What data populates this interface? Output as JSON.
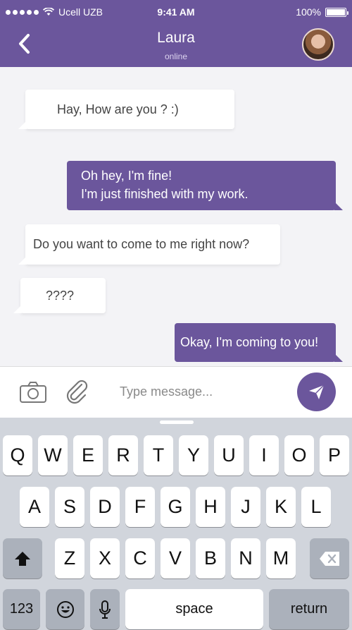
{
  "status_bar": {
    "carrier": "Ucell UZB",
    "time": "9:41 AM",
    "battery": "100%"
  },
  "contact": {
    "name": "Laura",
    "status": "online"
  },
  "messages": [
    {
      "direction": "incoming",
      "lines": [
        "Hay, How are you ? :)"
      ]
    },
    {
      "direction": "outgoing",
      "lines": [
        "Oh hey, I'm fine!",
        "I'm just finished with my work."
      ]
    },
    {
      "direction": "incoming",
      "lines": [
        "Do you want to come to me right now?"
      ]
    },
    {
      "direction": "incoming",
      "lines": [
        "????"
      ]
    },
    {
      "direction": "outgoing",
      "lines": [
        "Okay, I'm coming to you!"
      ]
    }
  ],
  "composer": {
    "placeholder": "Type message..."
  },
  "keyboard": {
    "row1": [
      "Q",
      "W",
      "E",
      "R",
      "T",
      "Y",
      "U",
      "I",
      "O",
      "P"
    ],
    "row2": [
      "A",
      "S",
      "D",
      "F",
      "G",
      "H",
      "J",
      "K",
      "L"
    ],
    "row3": [
      "Z",
      "X",
      "C",
      "V",
      "B",
      "N",
      "M"
    ],
    "numbers_label": "123",
    "space_label": "space",
    "return_label": "return"
  },
  "colors": {
    "accent": "#6b569c",
    "background": "#f3f3f6",
    "keyboard": "#d1d5dc"
  },
  "icons": [
    "back-chevron-icon",
    "wifi-icon",
    "camera-icon",
    "paperclip-icon",
    "send-icon",
    "shift-icon",
    "backspace-icon",
    "emoji-icon",
    "microphone-icon"
  ]
}
